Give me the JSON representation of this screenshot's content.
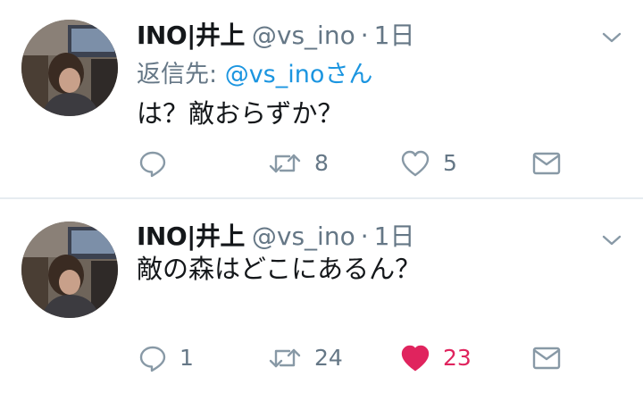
{
  "tweets": [
    {
      "display_name": "INO|井上",
      "handle": "@vs_ino",
      "separator": "·",
      "time": "1日",
      "reply_prefix": "返信先: ",
      "reply_mention": "@vs_inoさん",
      "text": "は？敵おらずか？",
      "reply_count": "",
      "retweet_count": "8",
      "like_count": "5",
      "liked": false
    },
    {
      "display_name": "INO|井上",
      "handle": "@vs_ino",
      "separator": "·",
      "time": "1日",
      "text": "敵の森はどこにあるん？",
      "reply_count": "1",
      "retweet_count": "24",
      "like_count": "23",
      "liked": true
    }
  ],
  "icons": {
    "reply": "speech-bubble-icon",
    "retweet": "retweet-arrows-icon",
    "like": "heart-icon",
    "dm": "envelope-icon",
    "caret": "chevron-down-icon"
  },
  "colors": {
    "text": "#14171a",
    "secondary": "#657786",
    "link": "#1b95e0",
    "like": "#e0245e",
    "divider": "#e6ecf0"
  }
}
